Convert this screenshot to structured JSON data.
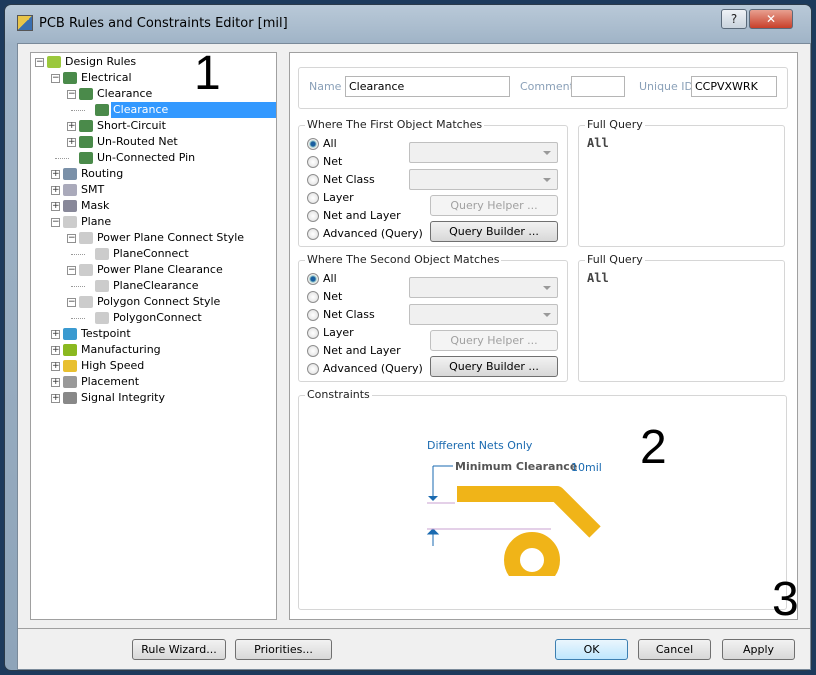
{
  "window": {
    "title": "PCB Rules and Constraints Editor [mil]",
    "help": "?",
    "close": "✕"
  },
  "tree": [
    {
      "label": "Design Rules",
      "level": 0,
      "exp": "−",
      "icon": "design-rules-icon"
    },
    {
      "label": "Electrical",
      "level": 1,
      "exp": "−",
      "icon": "electrical-icon"
    },
    {
      "label": "Clearance",
      "level": 2,
      "exp": "−",
      "icon": "electrical-icon"
    },
    {
      "label": "Clearance",
      "level": 3,
      "exp": "",
      "icon": "electrical-icon",
      "selected": true
    },
    {
      "label": "Short-Circuit",
      "level": 2,
      "exp": "+",
      "icon": "electrical-icon"
    },
    {
      "label": "Un-Routed Net",
      "level": 2,
      "exp": "+",
      "icon": "electrical-icon"
    },
    {
      "label": "Un-Connected Pin",
      "level": 2,
      "exp": "",
      "icon": "electrical-icon"
    },
    {
      "label": "Routing",
      "level": 1,
      "exp": "+",
      "icon": "routing-icon"
    },
    {
      "label": "SMT",
      "level": 1,
      "exp": "+",
      "icon": "smt-icon"
    },
    {
      "label": "Mask",
      "level": 1,
      "exp": "+",
      "icon": "mask-icon"
    },
    {
      "label": "Plane",
      "level": 1,
      "exp": "−",
      "icon": "plane-icon"
    },
    {
      "label": "Power Plane Connect Style",
      "level": 2,
      "exp": "−",
      "icon": "plane-icon"
    },
    {
      "label": "PlaneConnect",
      "level": 3,
      "exp": "",
      "icon": "plane-icon"
    },
    {
      "label": "Power Plane Clearance",
      "level": 2,
      "exp": "−",
      "icon": "plane-icon"
    },
    {
      "label": "PlaneClearance",
      "level": 3,
      "exp": "",
      "icon": "plane-icon"
    },
    {
      "label": "Polygon Connect Style",
      "level": 2,
      "exp": "−",
      "icon": "plane-icon"
    },
    {
      "label": "PolygonConnect",
      "level": 3,
      "exp": "",
      "icon": "plane-icon"
    },
    {
      "label": "Testpoint",
      "level": 1,
      "exp": "+",
      "icon": "testpoint-icon"
    },
    {
      "label": "Manufacturing",
      "level": 1,
      "exp": "+",
      "icon": "manufacturing-icon"
    },
    {
      "label": "High Speed",
      "level": 1,
      "exp": "+",
      "icon": "high-speed-icon"
    },
    {
      "label": "Placement",
      "level": 1,
      "exp": "+",
      "icon": "placement-icon"
    },
    {
      "label": "Signal Integrity",
      "level": 1,
      "exp": "+",
      "icon": "signal-integrity-icon"
    }
  ],
  "rule": {
    "name_label": "Name",
    "name": "Clearance",
    "comment_label": "Comment",
    "comment": "",
    "uid_label": "Unique ID",
    "uid": "CCPVXWRK"
  },
  "first": {
    "title": "Where The First Object Matches",
    "options": [
      "All",
      "Net",
      "Net Class",
      "Layer",
      "Net and Layer",
      "Advanced (Query)"
    ],
    "selected": "All",
    "query_helper": "Query Helper ...",
    "query_builder": "Query Builder ...",
    "full_query_title": "Full Query",
    "full_query": "All"
  },
  "second": {
    "title": "Where The Second Object Matches",
    "options": [
      "All",
      "Net",
      "Net Class",
      "Layer",
      "Net and Layer",
      "Advanced (Query)"
    ],
    "selected": "All",
    "query_helper": "Query Helper ...",
    "query_builder": "Query Builder ...",
    "full_query_title": "Full Query",
    "full_query": "All"
  },
  "constraints": {
    "title": "Constraints",
    "mode": "Different Nets Only",
    "min_label": "Minimum Clearance",
    "min_value": "10mil"
  },
  "annotations": [
    "1",
    "2",
    "3"
  ],
  "buttons": {
    "rule_wizard": "Rule Wizard...",
    "priorities": "Priorities...",
    "ok": "OK",
    "cancel": "Cancel",
    "apply": "Apply"
  },
  "colors": {
    "copper": "#f0b418",
    "accent": "#1a6ab0",
    "selection": "#3399ff"
  }
}
